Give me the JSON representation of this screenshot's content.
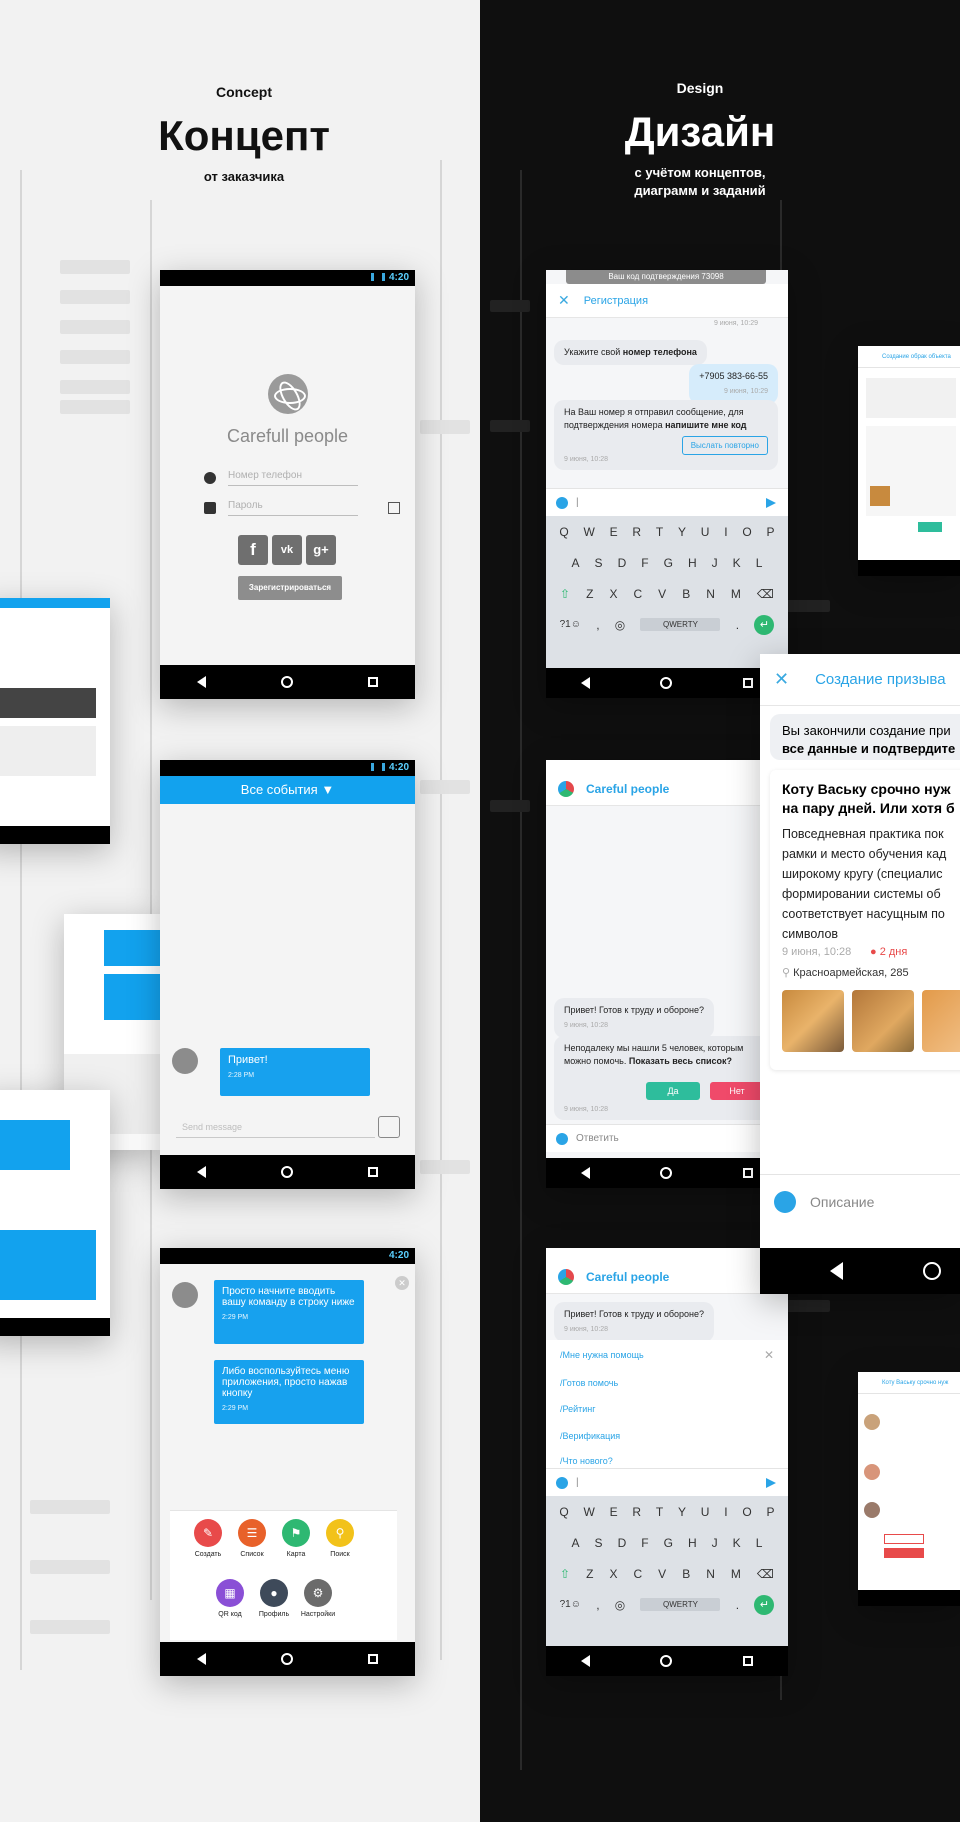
{
  "concept": {
    "label_small": "Concept",
    "title": "Концепт",
    "subtitle": "от заказчика",
    "status_time": "4:20",
    "login": {
      "app_name": "Carefull people",
      "phone_placeholder": "Номер телефон",
      "password_placeholder": "Пароль",
      "social": [
        "f",
        "vk",
        "g+"
      ],
      "register_label": "Зарегистрироваться"
    },
    "events": {
      "header": "Все события",
      "message": "Привет!",
      "message_time": "2:28 PM",
      "input_placeholder": "Send message"
    },
    "menu": {
      "msg1": "Просто начните вводить вашу команду в строку ниже",
      "msg1_time": "2:29 PM",
      "msg2": "Либо воспользуйтесь меню приложения, просто нажав кнопку",
      "msg2_time": "2:29 PM",
      "buttons": [
        {
          "label": "Создать",
          "color": "#e84a4a"
        },
        {
          "label": "Список",
          "color": "#e8612a"
        },
        {
          "label": "Карта",
          "color": "#2eb872"
        },
        {
          "label": "Поиск",
          "color": "#f2c21a"
        },
        {
          "label": "QR код",
          "color": "#8a4fd6"
        },
        {
          "label": "Профиль",
          "color": "#3e4a5a"
        },
        {
          "label": "Настройки",
          "color": "#6b6b6b"
        }
      ]
    }
  },
  "design": {
    "label_small": "Design",
    "title": "Дизайн",
    "subtitle_line1": "с учётом концептов,",
    "subtitle_line2": "диаграмм и заданий",
    "registration": {
      "header": "Регистрация",
      "toast": "Ваш код подтверждения 73098",
      "time_top": "9 июня, 10:29",
      "ask_phone_pre": "Укажите свой ",
      "ask_phone_bold": "номер телефона",
      "phone": "+7905 383-66-55",
      "phone_time": "9 июня, 10:29",
      "sms_pre": "На  Ваш номер я отправил сообщение, для подтверждения номера ",
      "sms_bold": "напишите мне код",
      "resend": "Выслать повторно",
      "sms_time": "9 июня, 10:28",
      "keyboard_space": "QWERTY"
    },
    "keyboard": {
      "row1": [
        "Q",
        "W",
        "E",
        "R",
        "T",
        "Y",
        "U",
        "I",
        "O",
        "P"
      ],
      "row2": [
        "A",
        "S",
        "D",
        "F",
        "G",
        "H",
        "J",
        "K",
        "L"
      ],
      "row3": [
        "Z",
        "X",
        "C",
        "V",
        "B",
        "N",
        "M"
      ],
      "sym": "?1☺"
    },
    "main": {
      "brand": "Careful people",
      "greet": "Привет! Готов к труду и обороне?",
      "greet_time": "9 июня, 10:28",
      "found_pre": "Неподалеку мы нашли 5 человек, которым можно помочь. ",
      "found_bold": "Показать весь список?",
      "yes": "Да",
      "no": "Нет",
      "found_time": "9 июня, 10:28",
      "reply": "Ответить"
    },
    "commands": {
      "brand": "Careful people",
      "greet": "Привет! Готов к труду и обороне?",
      "greet_time": "9 июня, 10:28",
      "items": [
        "/Мне нужна помощь",
        "/Готов помочь",
        "/Рейтинг",
        "/Верификация",
        "/Что нового?"
      ]
    },
    "creation": {
      "header": "Создание призыва",
      "done_pre": "Вы закончили создание при",
      "done_bold": "все данные и подтвердите",
      "post_title": "Коту Ваську срочно нуж на пару дней. Или хотя б",
      "post_body": "Повседневная практика пок рамки и место обучения кад широкому кругу (специалис формировании системы об соответствует насущным по символов",
      "post_time": "9 июня, 10:28",
      "deadline": "2 дня",
      "address": "Красноармейская, 285",
      "describe": "Описание"
    },
    "small_creation": {
      "header": "Создание обрак объекта"
    },
    "small_list": {
      "header": "Коту Ваську срочно нуж"
    }
  }
}
